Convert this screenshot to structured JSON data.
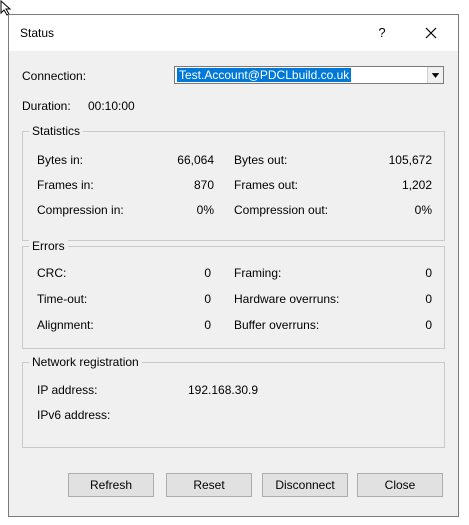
{
  "dialog": {
    "title": "Status",
    "help_label": "?"
  },
  "connection": {
    "label": "Connection:",
    "value": "Test.Account@PDCLbuild.co.uk"
  },
  "duration": {
    "label": "Duration:",
    "value": "00:10:00"
  },
  "statistics": {
    "title": "Statistics",
    "bytes_in_label": "Bytes in:",
    "bytes_in": "66,064",
    "bytes_out_label": "Bytes out:",
    "bytes_out": "105,672",
    "frames_in_label": "Frames in:",
    "frames_in": "870",
    "frames_out_label": "Frames out:",
    "frames_out": "1,202",
    "compression_in_label": "Compression in:",
    "compression_in": "0%",
    "compression_out_label": "Compression out:",
    "compression_out": "0%"
  },
  "errors": {
    "title": "Errors",
    "crc_label": "CRC:",
    "crc": "0",
    "framing_label": "Framing:",
    "framing": "0",
    "timeout_label": "Time-out:",
    "timeout": "0",
    "hw_overruns_label": "Hardware overruns:",
    "hw_overruns": "0",
    "alignment_label": "Alignment:",
    "alignment": "0",
    "buffer_overruns_label": "Buffer overruns:",
    "buffer_overruns": "0"
  },
  "network": {
    "title": "Network registration",
    "ip_label": "IP address:",
    "ip": "192.168.30.9",
    "ipv6_label": "IPv6 address:",
    "ipv6": ""
  },
  "buttons": {
    "refresh": "Refresh",
    "reset": "Reset",
    "disconnect": "Disconnect",
    "close": "Close"
  },
  "colors": {
    "selection": "#0078d7",
    "dialog_bg": "#f0f0f0",
    "button_bg": "#e1e1e1"
  },
  "icons": [
    "mouse-cursor-icon",
    "close-icon",
    "chevron-down-icon"
  ]
}
